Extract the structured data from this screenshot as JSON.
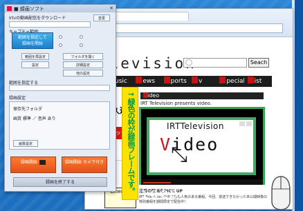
{
  "app": {
    "title": "■ 録画ソフト",
    "lines": [
      "Irtvの動画配信をダウンロード",
      "キャプチャ範囲:",
      "範囲を指定する",
      "録画設定",
      "保存先フォルダ",
      "画質 標準 ／ 音声 あり"
    ],
    "blue_button": "範囲を指定して\n録画を開始",
    "small_buttons": [
      "変更",
      "範囲を再設定",
      "フォルダを開く",
      "設定",
      "詳細設定",
      "他の設定",
      "画質設定"
    ],
    "red_button_left": "録画開始",
    "red_button_right": "録画開始 カメラ付き",
    "bottom_button": "録画を終了する"
  },
  "browser": {
    "logo": "elevision",
    "search_button": "Seach",
    "nav_items": [
      "usic",
      "ews",
      "ports",
      "v",
      "pecial",
      "ist"
    ],
    "left_heading_1": "eli",
    "left_heading_2": "の久送",
    "left_red_box": "リッ",
    "video_title": "ideo",
    "video_caption": "IRT Television presents video.",
    "player_title": "IRTTelevision",
    "player_video_first": "V",
    "player_video_rest": "ideo",
    "footer_thumb": "Cinema!",
    "footer_lines": [
      "注目の映画をPICK UP",
      "IRT Television の中で最も人気のある番組。今回、放送できなかった未公開映像の",
      "特別番組を期間限定で配信中！"
    ]
  },
  "annotation": {
    "text": "→緑色の枠が録画フレームです。"
  },
  "faded_word": "ideo"
}
